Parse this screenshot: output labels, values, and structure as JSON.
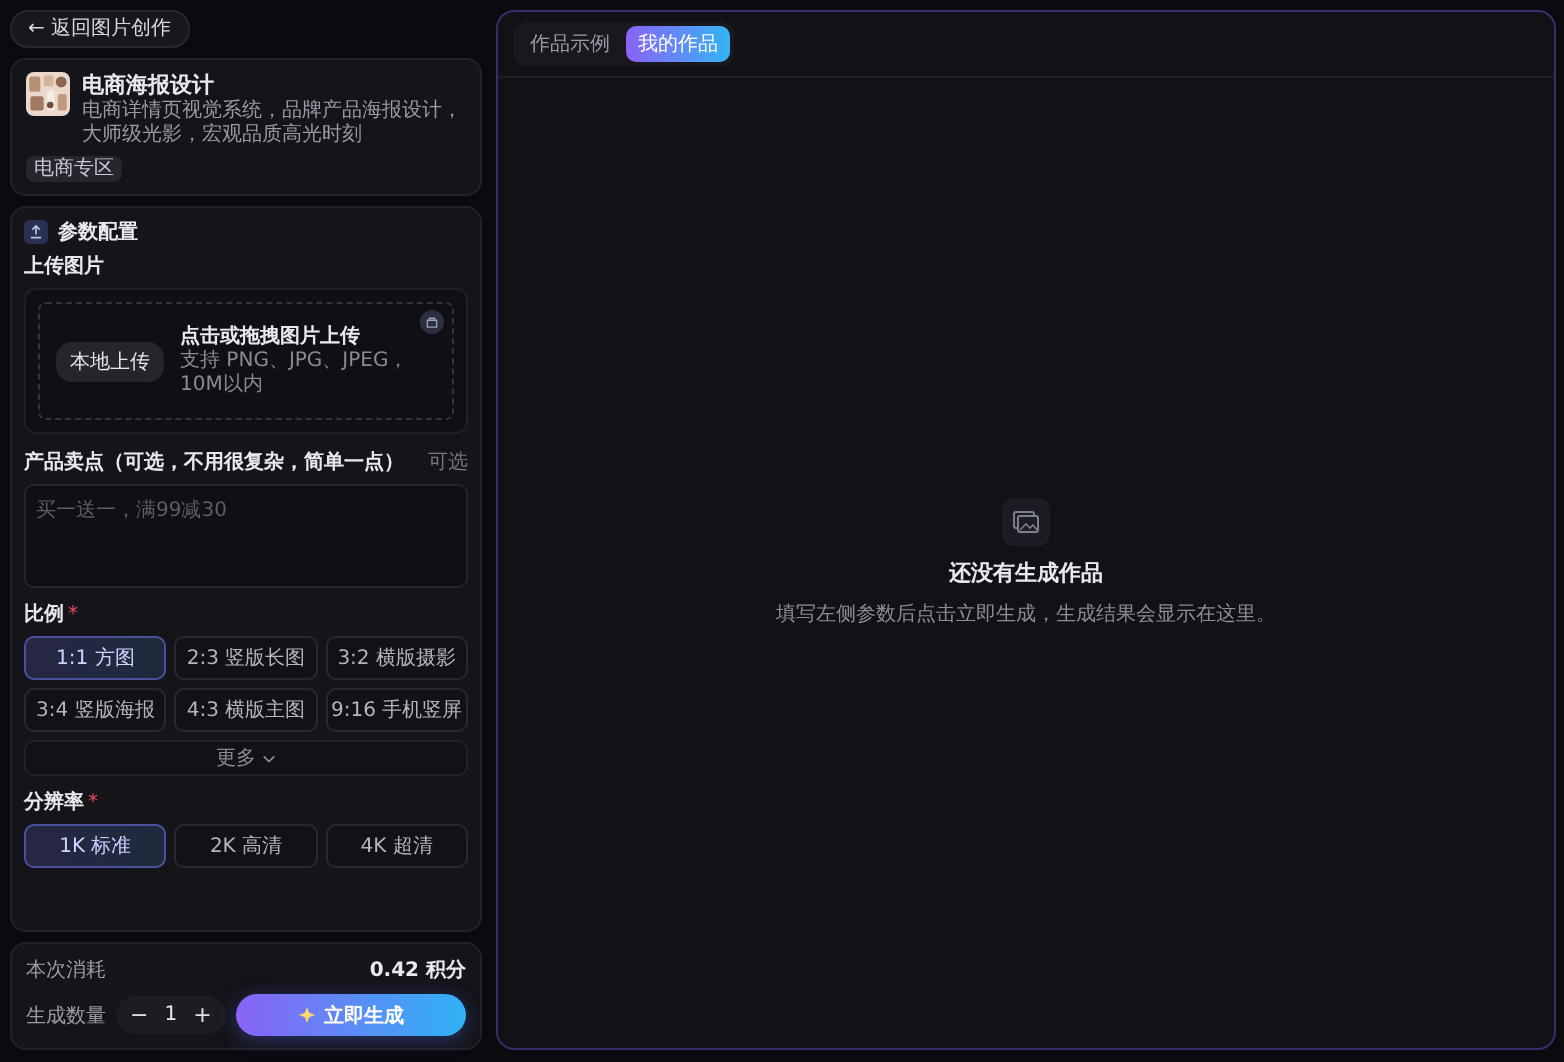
{
  "back_button": {
    "label": "← 返回图片创作"
  },
  "template": {
    "kind": "picture",
    "title": "电商海报设计",
    "description": "电商详情页视觉系统，品牌产品海报设计，大师级光影，宏观品质高光时刻",
    "tag": "电商专区"
  },
  "params": {
    "title": "参数配置",
    "upload": {
      "label": "上传图片",
      "button": "本地上传",
      "hint": "点击或拖拽图片上传",
      "formats": "支持 PNG、JPG、JPEG，10M以内"
    },
    "selling_points": {
      "label": "产品卖点（可选，不用很复杂，简单一点）",
      "note": "可选",
      "placeholder": "买一送一，满99减30"
    },
    "ratio": {
      "label": "比例",
      "required_mark": "*",
      "options": [
        {
          "label": "1:1 方图",
          "selected": true
        },
        {
          "label": "2:3 竖版长图",
          "selected": false
        },
        {
          "label": "3:2 横版摄影",
          "selected": false
        },
        {
          "label": "3:4 竖版海报",
          "selected": false
        },
        {
          "label": "4:3 横版主图",
          "selected": false
        },
        {
          "label": "9:16 手机竖屏",
          "selected": false
        }
      ],
      "more": "更多"
    },
    "resolution": {
      "label": "分辨率",
      "required_mark": "*",
      "options": [
        {
          "label": "1K 标准",
          "selected": true
        },
        {
          "label": "2K 高清",
          "selected": false
        },
        {
          "label": "4K 超清",
          "selected": false
        }
      ]
    }
  },
  "footer": {
    "cost_label": "本次消耗",
    "cost": "0.42 积分",
    "count_label": "生成数量",
    "minus": "−",
    "count": "1",
    "plus": "+",
    "generate": "立即生成"
  },
  "tabs": [
    {
      "label": "作品示例",
      "selected": false
    },
    {
      "label": "我的作品",
      "selected": true
    }
  ],
  "empty": {
    "title": "还没有生成作品",
    "message": "填写左侧参数后点击立即生成，生成结果会显示在这里。"
  }
}
